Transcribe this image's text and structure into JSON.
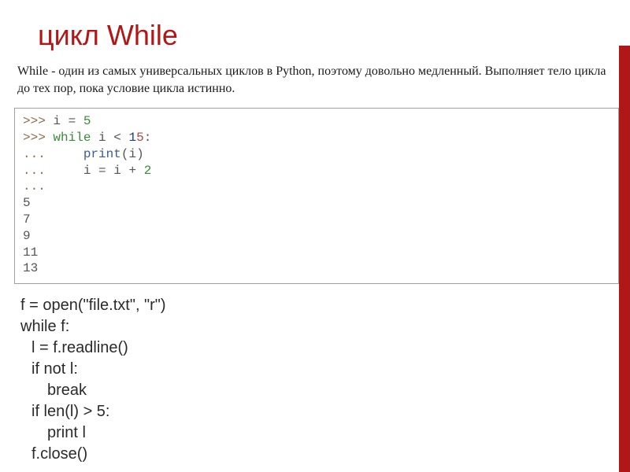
{
  "title": "цикл While",
  "description": "While - один из самых универсальных циклов в Python, поэтому довольно медленный. Выполняет тело цикла до тех пор, пока условие цикла истинно.",
  "code1": {
    "p1": ">>>",
    "kw_while": "while",
    "var": "i",
    "eq": "=",
    "lt": "<",
    "colon": ":",
    "plus": "+",
    "dots": "...",
    "fn_print": "print",
    "op": "(",
    "cp": ")",
    "n5": "5",
    "n1": "1",
    "n15_b": "5",
    "n2": "2",
    "out": [
      "5",
      "7",
      "9",
      "11",
      "13"
    ]
  },
  "code2": {
    "l1": "f = open(\"file.txt\", \"r\")",
    "l2": "while f:",
    "l3": "l = f.readline()",
    "l4": "if not l:",
    "l5": "break",
    "l6": "if len(l) > 5:",
    "l7": "print l",
    "l8": "f.close()"
  }
}
